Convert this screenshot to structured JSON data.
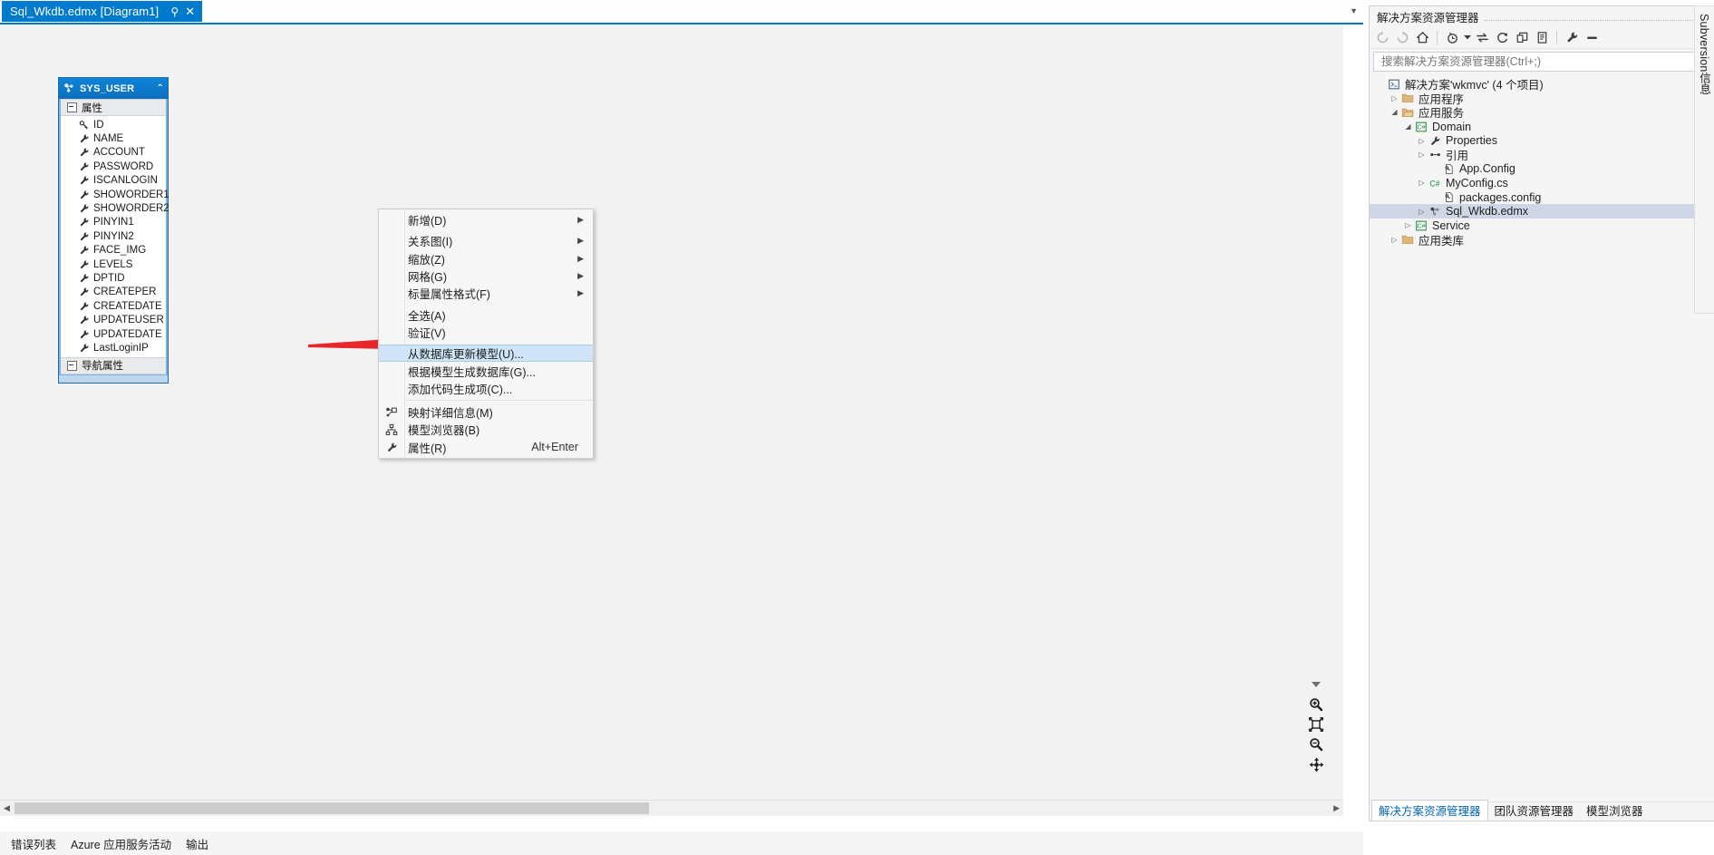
{
  "document_tab": {
    "title": "Sql_Wkdb.edmx [Diagram1]",
    "pin_icon": "pin-icon",
    "close_icon": "close-icon",
    "overflow_icon": "chevron-down-icon"
  },
  "entity": {
    "name": "SYS_USER",
    "entity_icon": "entity-icon",
    "collapse_icon": "chevron-up-icon",
    "sections": [
      {
        "label": "属性"
      },
      {
        "label": "导航属性"
      }
    ],
    "properties": [
      {
        "name": "ID",
        "icon": "key-icon"
      },
      {
        "name": "NAME",
        "icon": "scalar-property-icon"
      },
      {
        "name": "ACCOUNT",
        "icon": "scalar-property-icon"
      },
      {
        "name": "PASSWORD",
        "icon": "scalar-property-icon"
      },
      {
        "name": "ISCANLOGIN",
        "icon": "scalar-property-icon"
      },
      {
        "name": "SHOWORDER1",
        "icon": "scalar-property-icon"
      },
      {
        "name": "SHOWORDER2",
        "icon": "scalar-property-icon"
      },
      {
        "name": "PINYIN1",
        "icon": "scalar-property-icon"
      },
      {
        "name": "PINYIN2",
        "icon": "scalar-property-icon"
      },
      {
        "name": "FACE_IMG",
        "icon": "scalar-property-icon"
      },
      {
        "name": "LEVELS",
        "icon": "scalar-property-icon"
      },
      {
        "name": "DPTID",
        "icon": "scalar-property-icon"
      },
      {
        "name": "CREATEPER",
        "icon": "scalar-property-icon"
      },
      {
        "name": "CREATEDATE",
        "icon": "scalar-property-icon"
      },
      {
        "name": "UPDATEUSER",
        "icon": "scalar-property-icon"
      },
      {
        "name": "UPDATEDATE",
        "icon": "scalar-property-icon"
      },
      {
        "name": "LastLoginIP",
        "icon": "scalar-property-icon"
      }
    ]
  },
  "context_menu": {
    "items": [
      {
        "label": "新增(D)",
        "submenu": true,
        "icon": null,
        "shortcut": ""
      },
      {
        "label": "关系图(I)",
        "submenu": true,
        "icon": null,
        "shortcut": ""
      },
      {
        "label": "缩放(Z)",
        "submenu": true,
        "icon": null,
        "shortcut": ""
      },
      {
        "label": "网格(G)",
        "submenu": true,
        "icon": null,
        "shortcut": ""
      },
      {
        "label": "标量属性格式(F)",
        "submenu": true,
        "icon": null,
        "shortcut": ""
      },
      {
        "label": "全选(A)",
        "submenu": false,
        "icon": null,
        "shortcut": ""
      },
      {
        "label": "验证(V)",
        "submenu": false,
        "icon": null,
        "shortcut": ""
      },
      {
        "label": "从数据库更新模型(U)...",
        "submenu": false,
        "icon": null,
        "shortcut": "",
        "selected": true
      },
      {
        "label": "根据模型生成数据库(G)...",
        "submenu": false,
        "icon": null,
        "shortcut": ""
      },
      {
        "label": "添加代码生成项(C)...",
        "submenu": false,
        "icon": null,
        "shortcut": ""
      },
      {
        "label": "映射详细信息(M)",
        "submenu": false,
        "icon": "mapping-details-icon",
        "shortcut": ""
      },
      {
        "label": "模型浏览器(B)",
        "submenu": false,
        "icon": "model-browser-icon",
        "shortcut": ""
      },
      {
        "label": "属性(R)",
        "submenu": false,
        "icon": "properties-wrench-icon",
        "shortcut": "Alt+Enter"
      }
    ]
  },
  "solution_explorer": {
    "title": "解决方案资源管理器",
    "title_buttons": [
      {
        "name": "window-dropdown-icon",
        "glyph": "▾"
      },
      {
        "name": "pin-icon",
        "glyph": "⚲"
      },
      {
        "name": "close-icon",
        "glyph": "✕"
      }
    ],
    "toolbar": [
      {
        "name": "back-icon"
      },
      {
        "name": "forward-icon"
      },
      {
        "name": "home-icon"
      },
      {
        "name": "pending-changes-icon"
      },
      {
        "name": "sync-with-active-document-icon"
      },
      {
        "name": "refresh-icon"
      },
      {
        "name": "collapse-all-icon"
      },
      {
        "name": "show-all-files-icon"
      },
      {
        "name": "properties-wrench-icon"
      },
      {
        "name": "preview-selected-items-icon"
      }
    ],
    "search": {
      "placeholder": "搜索解决方案资源管理器(Ctrl+;)",
      "value": "",
      "search_icon": "search-icon",
      "dropdown_icon": "chevron-down-icon"
    },
    "tree": [
      {
        "label": "解决方案'wkmvc' (4 个项目)",
        "depth": 0,
        "twisty": "",
        "icon": "solution-icon",
        "selected": false
      },
      {
        "label": "应用程序",
        "depth": 1,
        "twisty": "▷",
        "icon": "folder-icon",
        "selected": false
      },
      {
        "label": "应用服务",
        "depth": 1,
        "twisty": "◢",
        "icon": "folder-open-icon",
        "selected": false
      },
      {
        "label": "Domain",
        "depth": 2,
        "twisty": "◢",
        "icon": "csharp-project-icon",
        "selected": false
      },
      {
        "label": "Properties",
        "depth": 3,
        "twisty": "▷",
        "icon": "properties-wrench-icon",
        "selected": false
      },
      {
        "label": "引用",
        "depth": 3,
        "twisty": "▷",
        "icon": "references-icon",
        "selected": false
      },
      {
        "label": "App.Config",
        "depth": 4,
        "twisty": "",
        "icon": "config-file-icon",
        "selected": false
      },
      {
        "label": "MyConfig.cs",
        "depth": 3,
        "twisty": "▷",
        "icon": "csharp-file-icon",
        "selected": false
      },
      {
        "label": "packages.config",
        "depth": 4,
        "twisty": "",
        "icon": "config-file-icon",
        "selected": false
      },
      {
        "label": "Sql_Wkdb.edmx",
        "depth": 3,
        "twisty": "▷",
        "icon": "edmx-file-icon",
        "selected": true
      },
      {
        "label": "Service",
        "depth": 2,
        "twisty": "▷",
        "icon": "csharp-project-icon",
        "selected": false
      },
      {
        "label": "应用类库",
        "depth": 1,
        "twisty": "▷",
        "icon": "folder-icon",
        "selected": false
      }
    ],
    "tabs": [
      {
        "label": "解决方案资源管理器",
        "active": true
      },
      {
        "label": "团队资源管理器",
        "active": false
      },
      {
        "label": "模型浏览器",
        "active": false
      }
    ]
  },
  "right_dock": {
    "label": "Subversion信息"
  },
  "zoom_tools": [
    {
      "name": "zoom-collapse-icon",
      "glyph": "▾"
    },
    {
      "name": "zoom-in-icon",
      "glyph": "+"
    },
    {
      "name": "zoom-to-fit-icon",
      "glyph": "⛶"
    },
    {
      "name": "zoom-out-icon",
      "glyph": "−"
    },
    {
      "name": "pan-icon",
      "glyph": "✥"
    }
  ],
  "bottom_tabs": [
    {
      "label": "错误列表"
    },
    {
      "label": "Azure 应用服务活动"
    },
    {
      "label": "输出"
    }
  ],
  "colors": {
    "accent": "#007acc",
    "entity_header": "#0b7ad0",
    "menu_selected": "#cfe4f7",
    "tree_selected": "#cfd6e6",
    "arrow_red": "#e8272c"
  }
}
